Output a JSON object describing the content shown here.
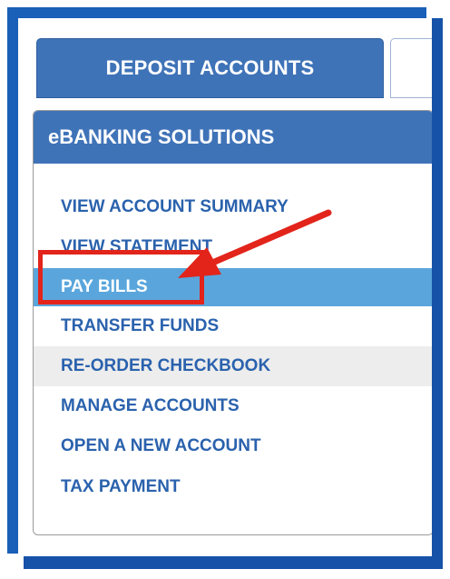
{
  "tabs": [
    {
      "label": "DEPOSIT ACCOUNTS"
    },
    {
      "label": "("
    }
  ],
  "panel": {
    "title": "eBANKING SOLUTIONS",
    "items": [
      {
        "label": "VIEW ACCOUNT SUMMARY"
      },
      {
        "label": "VIEW STATEMENT"
      },
      {
        "label": "PAY BILLS",
        "state": "active"
      },
      {
        "label": "TRANSFER FUNDS"
      },
      {
        "label": "RE-ORDER CHECKBOOK",
        "state": "highlighted"
      },
      {
        "label": "MANAGE ACCOUNTS"
      },
      {
        "label": "OPEN A NEW ACCOUNT"
      },
      {
        "label": "TAX PAYMENT"
      }
    ]
  },
  "annotation": {
    "highlight_color": "#e2241b",
    "target": "PAY BILLS"
  },
  "colors": {
    "brand_blue": "#3f73b8",
    "frame_blue": "#1a5fb8",
    "link_blue": "#2a62ad",
    "active_bg": "#5aa6dc"
  }
}
